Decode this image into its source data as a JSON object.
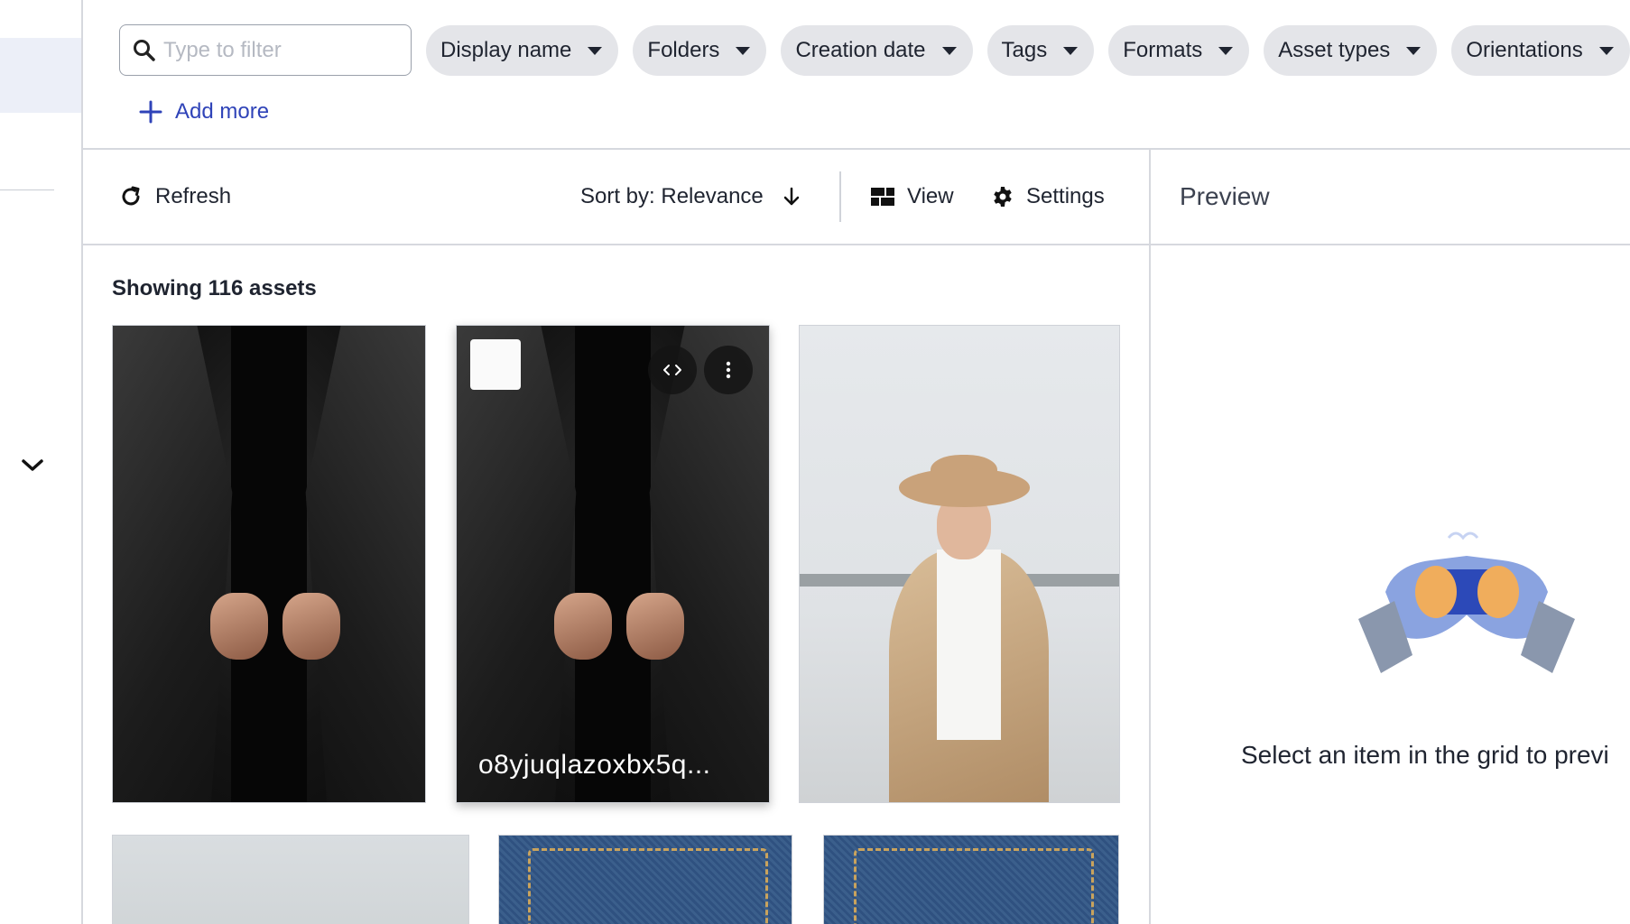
{
  "sidebar": {
    "icons": [
      "chevron-down-icon"
    ]
  },
  "filters": {
    "search_placeholder": "Type to filter",
    "chips": [
      "Display name",
      "Folders",
      "Creation date",
      "Tags",
      "Formats",
      "Asset types",
      "Orientations"
    ],
    "add_more": "Add more"
  },
  "toolbar": {
    "refresh": "Refresh",
    "sort": "Sort by: Relevance",
    "view": "View",
    "settings": "Settings"
  },
  "grid": {
    "count": "Showing 116 assets",
    "hovered_asset_label": "o8yjuqlazoxbx5q..."
  },
  "preview": {
    "title": "Preview",
    "empty_message": "Select an item in the grid to previ"
  },
  "colors": {
    "accent": "#2f43b8",
    "chip_bg": "#e4e5e9",
    "sidebar_active": "#eceff8"
  }
}
